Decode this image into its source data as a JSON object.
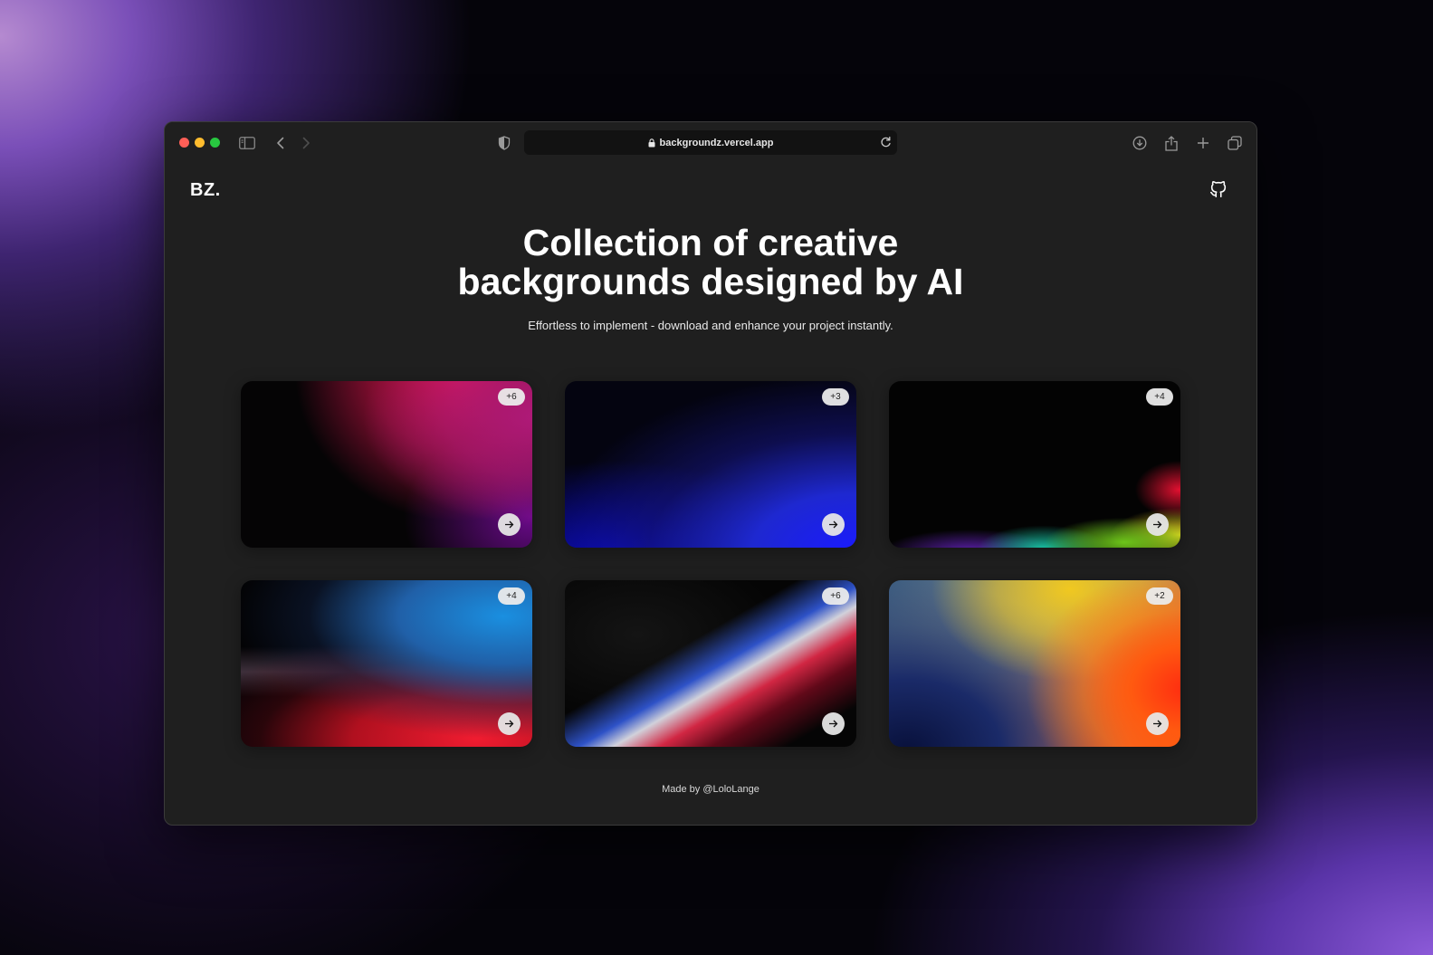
{
  "browser": {
    "url": "backgroundz.vercel.app"
  },
  "header": {
    "logo": "BZ."
  },
  "hero": {
    "title_line1": "Collection of creative",
    "title_line2": "backgrounds designed by AI",
    "subtitle": "Effortless to implement - download and enhance your project instantly."
  },
  "cards": [
    {
      "badge": "+6",
      "palette": [
        "#e0154f",
        "#b01a7a",
        "#6a0a8a"
      ]
    },
    {
      "badge": "+3",
      "palette": [
        "#1a1aff",
        "#1e28d0"
      ]
    },
    {
      "badge": "+4",
      "palette": [
        "#e01030",
        "#e8d020",
        "#6cc41a",
        "#18c0a0",
        "#5a1fa8"
      ]
    },
    {
      "badge": "+4",
      "palette": [
        "#1a8fe0",
        "#f01c30"
      ]
    },
    {
      "badge": "+6",
      "palette": [
        "#325adc",
        "#dcdce6",
        "#dc2846"
      ]
    },
    {
      "badge": "+2",
      "palette": [
        "#f0c820",
        "#ff2a10",
        "#08103a"
      ]
    }
  ],
  "footer": {
    "text": "Made by @LoloLange"
  },
  "icons": {
    "sidebar": "sidebar-icon",
    "back": "chevron-left-icon",
    "forward": "chevron-right-icon",
    "privacy": "shield-icon",
    "lock": "lock-icon",
    "reload": "reload-icon",
    "download": "download-icon",
    "share": "share-icon",
    "new_tab": "plus-icon",
    "tabs": "tabs-overview-icon",
    "github": "github-icon",
    "card_open": "arrow-right-icon"
  }
}
